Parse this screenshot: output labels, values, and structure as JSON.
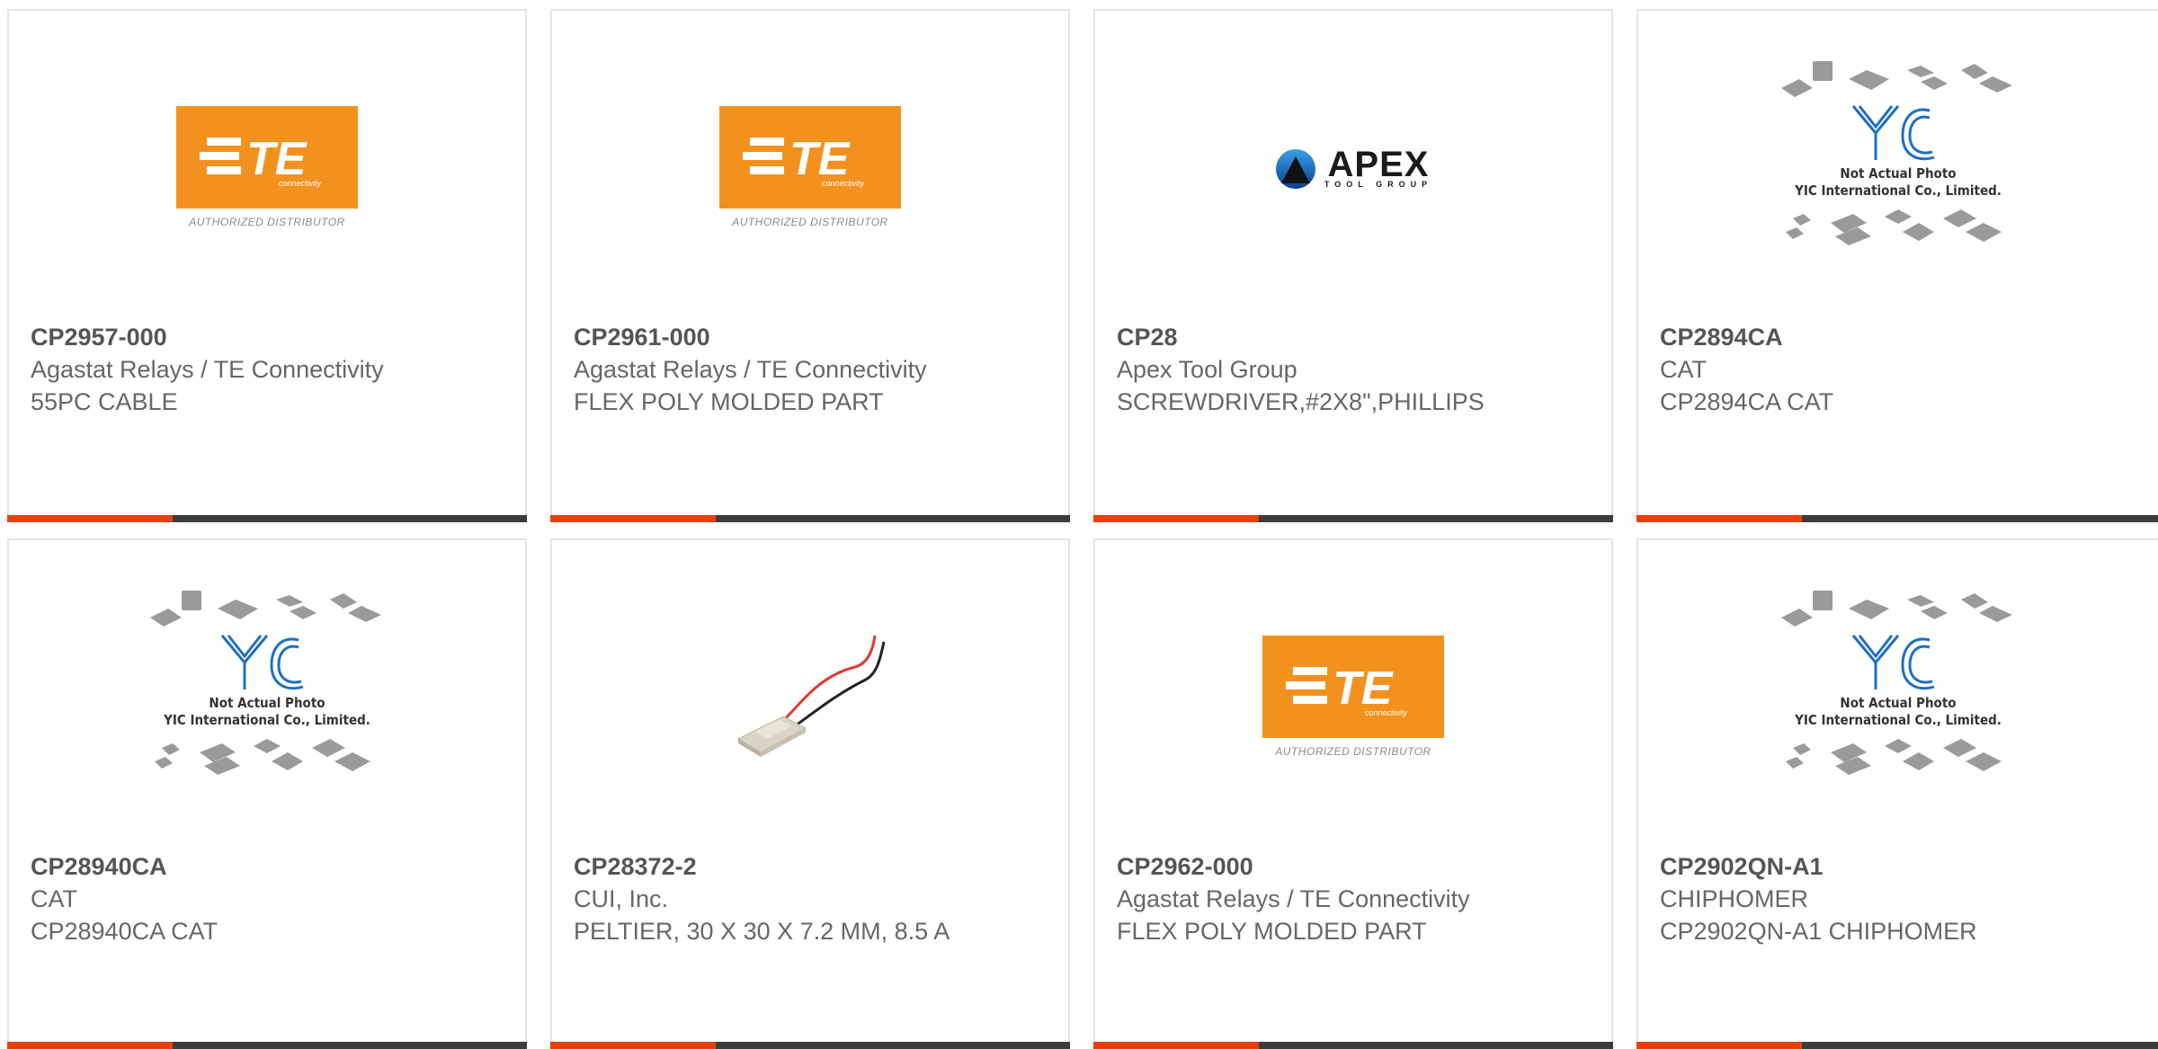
{
  "products": [
    {
      "part_number": "CP2957-000",
      "manufacturer": "Agastat Relays / TE Connectivity",
      "description": "55PC CABLE",
      "image": "te-logo"
    },
    {
      "part_number": "CP2961-000",
      "manufacturer": "Agastat Relays / TE Connectivity",
      "description": "FLEX POLY MOLDED PART",
      "image": "te-logo"
    },
    {
      "part_number": "CP28",
      "manufacturer": "Apex Tool Group",
      "description": "SCREWDRIVER,#2X8\",PHILLIPS",
      "image": "apex-logo"
    },
    {
      "part_number": "CP2894CA",
      "manufacturer": "CAT",
      "description": "CP2894CA CAT",
      "image": "yic-placeholder"
    },
    {
      "part_number": "CP28940CA",
      "manufacturer": "CAT",
      "description": "CP28940CA CAT",
      "image": "yic-placeholder"
    },
    {
      "part_number": "CP28372-2",
      "manufacturer": "CUI, Inc.",
      "description": "PELTIER, 30 X 30 X 7.2 MM, 8.5 A",
      "image": "peltier-photo"
    },
    {
      "part_number": "CP2962-000",
      "manufacturer": "Agastat Relays / TE Connectivity",
      "description": "FLEX POLY MOLDED PART",
      "image": "te-logo"
    },
    {
      "part_number": "CP2902QN-A1",
      "manufacturer": "CHIPHOMER",
      "description": "CP2902QN-A1 CHIPHOMER",
      "image": "yic-placeholder"
    }
  ],
  "logos": {
    "te_word": "TE",
    "te_sub": "connectivity",
    "te_caption": "AUTHORIZED DISTRIBUTOR",
    "apex_word": "APEX",
    "apex_sub": "TOOL GROUP",
    "yic_caption_1": "Not Actual Photo",
    "yic_caption_2": "YIC International Co., Limited."
  },
  "colors": {
    "accent": "#e8400c",
    "bar": "#3c3c3c",
    "te_orange": "#f3911f",
    "yic_blue": "#1e6fc4"
  }
}
